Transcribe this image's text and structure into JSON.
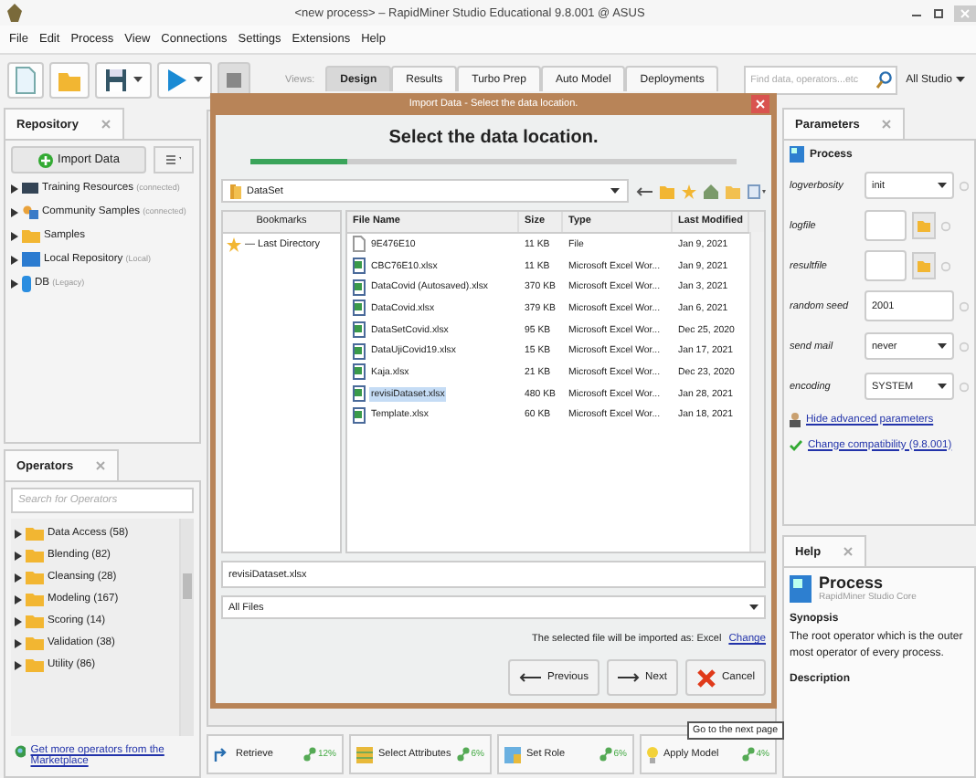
{
  "window": {
    "title": "<new process> – RapidMiner Studio Educational 9.8.001 @ ASUS"
  },
  "menu": [
    "File",
    "Edit",
    "Process",
    "View",
    "Connections",
    "Settings",
    "Extensions",
    "Help"
  ],
  "views_label": "Views:",
  "view_tabs": [
    {
      "label": "Design",
      "selected": true
    },
    {
      "label": "Results",
      "selected": false
    },
    {
      "label": "Turbo Prep",
      "selected": false
    },
    {
      "label": "Auto Model",
      "selected": false
    },
    {
      "label": "Deployments",
      "selected": false
    }
  ],
  "search": {
    "placeholder": "Find data, operators...etc"
  },
  "scope": "All Studio",
  "repository": {
    "title": "Repository",
    "import_button": "Import Data",
    "items": [
      {
        "label": "Training Resources",
        "note": "(connected)",
        "kind": "training"
      },
      {
        "label": "Community Samples",
        "note": "(connected)",
        "kind": "community"
      },
      {
        "label": "Samples",
        "kind": "folder"
      },
      {
        "label": "Local Repository",
        "note": "(Local)",
        "kind": "local"
      },
      {
        "label": "DB",
        "note": "(Legacy)",
        "kind": "db"
      }
    ]
  },
  "operators": {
    "title": "Operators",
    "search_placeholder": "Search for Operators",
    "items": [
      "Data Access (58)",
      "Blending (82)",
      "Cleansing (28)",
      "Modeling (167)",
      "Scoring (14)",
      "Validation (38)",
      "Utility (86)"
    ],
    "marketplace_link": "Get more operators from the Marketplace"
  },
  "recommended": [
    {
      "name": "Retrieve",
      "percent": "12%",
      "kind": "retrieve"
    },
    {
      "name": "Select Attributes",
      "percent": "6%",
      "kind": "select"
    },
    {
      "name": "Set Role",
      "percent": "6%",
      "kind": "role"
    },
    {
      "name": "Apply Model",
      "percent": "4%",
      "kind": "model"
    }
  ],
  "dialog": {
    "title": "Import Data - Select the data location.",
    "heading": "Select the data location.",
    "progress": {
      "level": 0.2
    },
    "location": "DataSet",
    "bookmarks_header": "Bookmarks",
    "bookmarks": [
      "— Last Directory"
    ],
    "columns": [
      "File Name",
      "Size",
      "Type",
      "Last Modified"
    ],
    "files": [
      {
        "name": "9E476E10",
        "size": "11 KB",
        "type": "File",
        "modified": "Jan 9, 2021",
        "kind": "file",
        "selected": false
      },
      {
        "name": "CBC76E10.xlsx",
        "size": "11 KB",
        "type": "Microsoft Excel Wor...",
        "modified": "Jan 9, 2021",
        "kind": "excel",
        "selected": false
      },
      {
        "name": "DataCovid (Autosaved).xlsx",
        "size": "370 KB",
        "type": "Microsoft Excel Wor...",
        "modified": "Jan 3, 2021",
        "kind": "excel",
        "selected": false
      },
      {
        "name": "DataCovid.xlsx",
        "size": "379 KB",
        "type": "Microsoft Excel Wor...",
        "modified": "Jan 6, 2021",
        "kind": "excel",
        "selected": false
      },
      {
        "name": "DataSetCovid.xlsx",
        "size": "95 KB",
        "type": "Microsoft Excel Wor...",
        "modified": "Dec 25, 2020",
        "kind": "excel",
        "selected": false
      },
      {
        "name": "DataUjiCovid19.xlsx",
        "size": "15 KB",
        "type": "Microsoft Excel Wor...",
        "modified": "Jan 17, 2021",
        "kind": "excel",
        "selected": false
      },
      {
        "name": "Kaja.xlsx",
        "size": "21 KB",
        "type": "Microsoft Excel Wor...",
        "modified": "Dec 23, 2020",
        "kind": "excel",
        "selected": false
      },
      {
        "name": "revisiDataset.xlsx",
        "size": "480 KB",
        "type": "Microsoft Excel Wor...",
        "modified": "Jan 28, 2021",
        "kind": "excel",
        "selected": true
      },
      {
        "name": "Template.xlsx",
        "size": "60 KB",
        "type": "Microsoft Excel Wor...",
        "modified": "Jan 18, 2021",
        "kind": "excel",
        "selected": false
      }
    ],
    "file_name": "revisiDataset.xlsx",
    "filter": "All Files",
    "import_note": "The selected file will be imported as: Excel",
    "change_link": "Change",
    "buttons": [
      {
        "label": "Previous",
        "kind": "previous"
      },
      {
        "label": "Next",
        "kind": "next"
      },
      {
        "label": "Cancel",
        "kind": "cancel"
      }
    ],
    "tooltip": "Go to the next page"
  },
  "parameters": {
    "title": "Parameters",
    "process": "Process",
    "rows": [
      {
        "label": "logverbosity",
        "kind": "select",
        "value": "init"
      },
      {
        "label": "logfile",
        "kind": "file"
      },
      {
        "label": "resultfile",
        "kind": "file"
      },
      {
        "label": "random seed",
        "kind": "text",
        "value": "2001"
      },
      {
        "label": "send mail",
        "kind": "select",
        "value": "never"
      },
      {
        "label": "encoding",
        "kind": "select",
        "value": "SYSTEM"
      }
    ],
    "hide_link": "Hide advanced parameters",
    "compat_link": "Change compatibility (9.8.001)"
  },
  "help": {
    "title": "Help",
    "heading": "Process",
    "subtitle": "RapidMiner Studio Core",
    "synopsis_title": "Synopsis",
    "synopsis": "The root operator which is the outer most operator of every process.",
    "description_title": "Description"
  }
}
